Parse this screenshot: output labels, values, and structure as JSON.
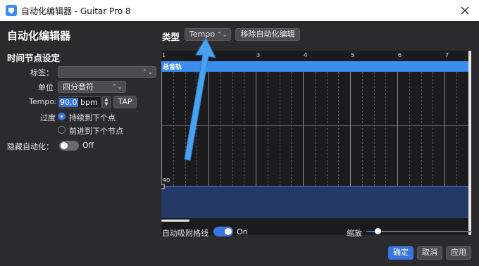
{
  "window": {
    "title": "自动化编辑器 - Guitar Pro 8"
  },
  "left": {
    "heading": "自动化编辑器",
    "section": "时间节点设定",
    "tag_label": "标签：",
    "tag_value": "",
    "unit_label": "单位",
    "unit_value": "四分音符",
    "tempo_label": "Tempo:",
    "tempo_number": "90.0",
    "tempo_unit": " bpm",
    "tap_label": "TAP",
    "transition_label": "过度",
    "transition_options": [
      "持续到下个点",
      "前进到下个节点"
    ],
    "transition_selected": 0,
    "hide_label": "隐藏自动化：",
    "hide_state": "Off"
  },
  "top": {
    "type_label": "类型",
    "type_value": "Tempo",
    "remove_label": "移除自动化编辑"
  },
  "grid": {
    "track_label": "总音轨",
    "measures": [
      "1",
      "2",
      "3",
      "4",
      "5",
      "6",
      "7"
    ],
    "point_value": "90"
  },
  "bottom": {
    "snap_label": "自动吸附格线",
    "snap_state": "On",
    "zoom_label": "缩放",
    "zoom_level": 0.05,
    "ok": "确定",
    "cancel": "取消",
    "apply": "应用"
  },
  "colors": {
    "accent": "#3a74e0",
    "track": "#3a8ef0",
    "area": "#243a66",
    "arrow": "#4aa3f0"
  },
  "icons": [
    "app-icon",
    "close-icon",
    "chevron-updown-icon",
    "arrow-annotation-icon"
  ]
}
